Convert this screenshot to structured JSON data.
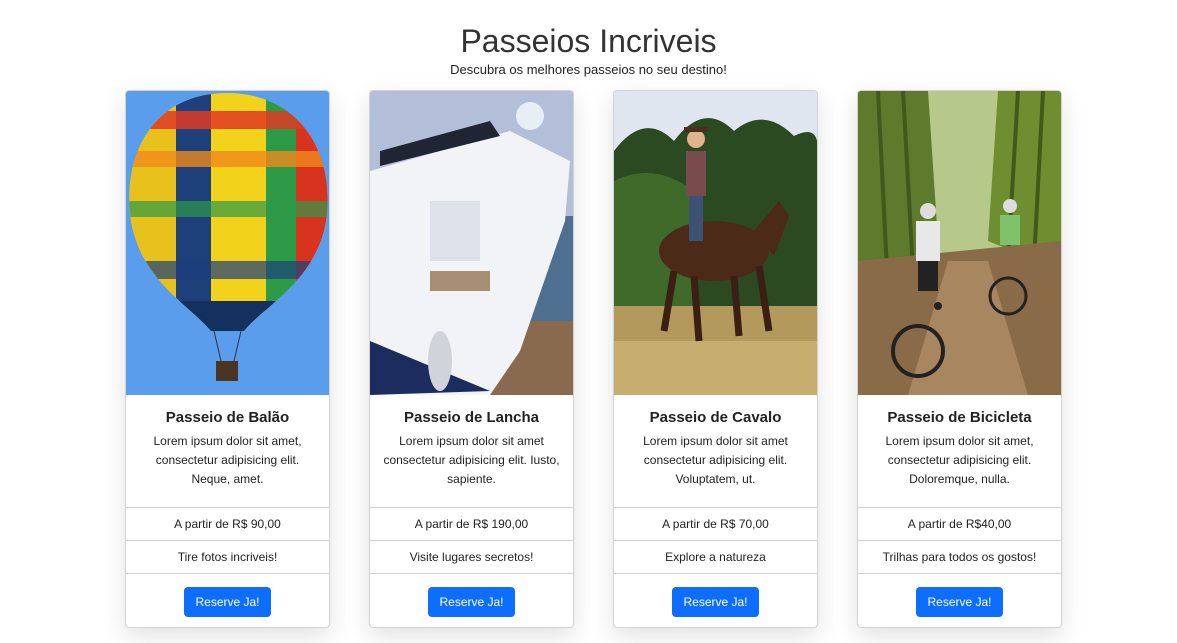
{
  "header": {
    "title": "Passeios Incriveis",
    "subtitle": "Descubra os melhores passeios no seu destino!"
  },
  "cards": [
    {
      "title": "Passeio de Balão",
      "text": "Lorem ipsum dolor sit amet, consectetur adipisicing elit. Neque, amet.",
      "price": "A partir de R$ 90,00",
      "tagline": "Tire fotos incriveis!",
      "button": "Reserve Ja!",
      "image": "hot-air-balloon-photo"
    },
    {
      "title": "Passeio de Lancha",
      "text": "Lorem ipsum dolor sit amet consectetur adipisicing elit. Iusto, sapiente.",
      "price": "A partir de R$ 190,00",
      "tagline": "Visite lugares secretos!",
      "button": "Reserve Ja!",
      "image": "speedboat-photo"
    },
    {
      "title": "Passeio de Cavalo",
      "text": "Lorem ipsum dolor sit amet consectetur adipisicing elit. Voluptatem, ut.",
      "price": "A partir de R$ 70,00",
      "tagline": "Explore a natureza",
      "button": "Reserve Ja!",
      "image": "horse-rider-photo"
    },
    {
      "title": "Passeio de Bicicleta",
      "text": "Lorem ipsum dolor sit amet, consectetur adipisicing elit. Doloremque, nulla.",
      "price": "A partir de R$40,00",
      "tagline": "Trilhas para todos os gostos!",
      "button": "Reserve Ja!",
      "image": "bicycle-trail-photo"
    }
  ],
  "colors": {
    "primary_button": "#0d6efd"
  }
}
